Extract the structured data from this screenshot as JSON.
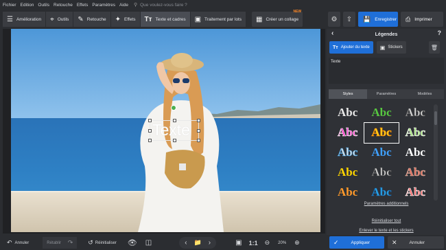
{
  "menu": [
    "Fichier",
    "Edition",
    "Outils",
    "Retouche",
    "Effets",
    "Paramètres",
    "Aide"
  ],
  "search_placeholder": "Que voulez-vous faire ?",
  "tools": [
    {
      "label": "Amélioration",
      "icon": "sliders-icon"
    },
    {
      "label": "Outils",
      "icon": "crop-icon"
    },
    {
      "label": "Retouche",
      "icon": "brush-icon"
    },
    {
      "label": "Effets",
      "icon": "magic-wand-icon"
    },
    {
      "label": "Texte et cadres",
      "icon": "text-icon"
    },
    {
      "label": "Traitement par lots",
      "icon": "batch-icon"
    }
  ],
  "collage": {
    "label": "Créer un collage",
    "badge": "NEW"
  },
  "save_label": "Enregistrer",
  "print_label": "Imprimer",
  "photo": {
    "text_box": "Texte"
  },
  "panel": {
    "title": "Légendes",
    "add_text": "Ajouter du texte",
    "stickers": "Stickers",
    "text_value": "Texte",
    "tabs": [
      "Styles",
      "Paramètres",
      "Modèles"
    ],
    "style_sample": "Abc",
    "styles": [
      {
        "color": "#e8e8e8",
        "stroke": "none"
      },
      {
        "color": "#58c840",
        "stroke": "none"
      },
      {
        "color": "#d9d9d9",
        "stroke": "#555"
      },
      {
        "color": "#ff3cc8",
        "stroke": "#ffffff"
      },
      {
        "color": "#ffd21c",
        "stroke": "#ff8a00"
      },
      {
        "color": "#a4e37a",
        "stroke": "#ffffff"
      },
      {
        "color": "#dcdcdc",
        "stroke": "#3b9be0"
      },
      {
        "color": "#3fa0ff",
        "stroke": "none"
      },
      {
        "color": "#ffffff",
        "stroke": "none"
      },
      {
        "color": "#ffd400",
        "stroke": "none"
      },
      {
        "color": "#d0d0d0",
        "stroke": "#444"
      },
      {
        "color": "#e07060",
        "stroke": "#d9b0a0"
      },
      {
        "color": "#ff9a2a",
        "stroke": "none"
      },
      {
        "color": "#2aa6e8",
        "stroke": "#1a5fa0"
      },
      {
        "color": "#ff6a6a",
        "stroke": "#ffffff"
      }
    ],
    "extra_params": "Paramètres additionnels",
    "reset_all": "Réinitialiser tout",
    "remove_all": "Enlever le texte et les stickers"
  },
  "bottom": {
    "undo": "Annuler",
    "redo": "Rétablir",
    "reset": "Réinitialiser",
    "ratio": "1:1",
    "zoom": "20%",
    "apply": "Appliquer",
    "cancel": "Annuler"
  },
  "colors": {
    "accent": "#1f6fd8",
    "bg": "#2b2d31"
  }
}
